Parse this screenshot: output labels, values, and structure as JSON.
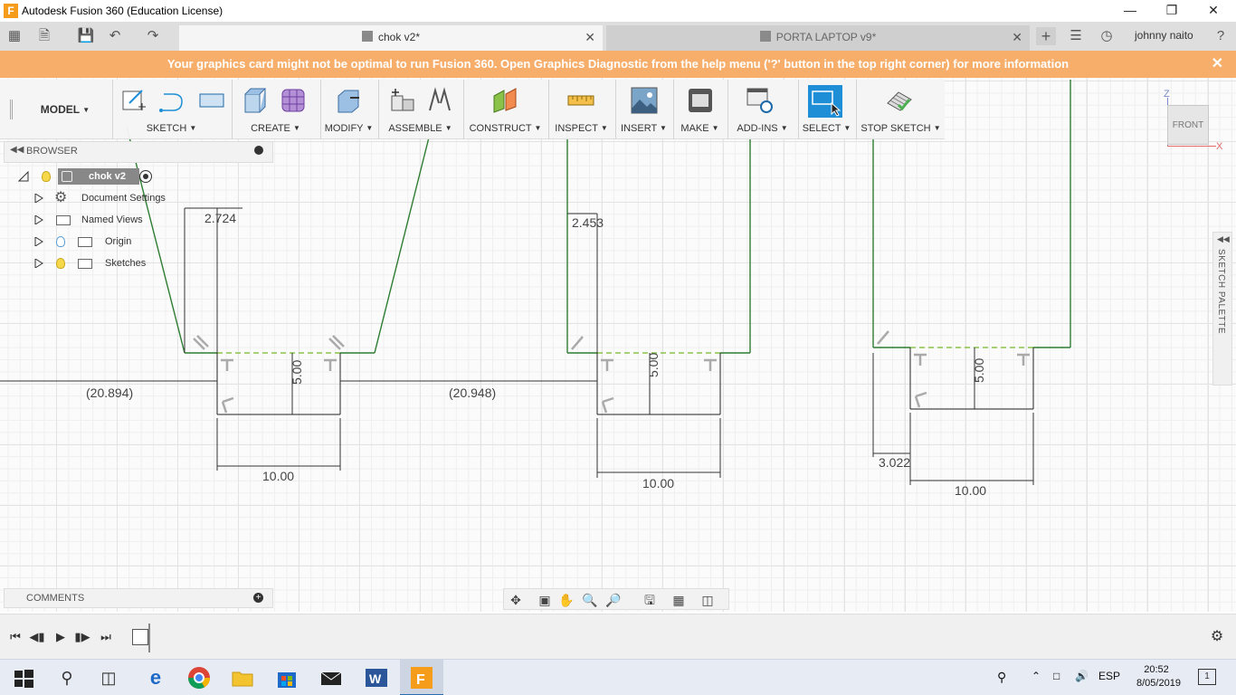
{
  "window": {
    "title": "Autodesk Fusion 360 (Education License)",
    "app_icon_letter": "F",
    "minimize_icon": "minimize-icon",
    "maximize_icon": "restore-icon",
    "close_icon": "close-icon"
  },
  "tabs": [
    {
      "label": "chok v2*",
      "active": true
    },
    {
      "label": "PORTA LAPTOP v9*",
      "active": false
    }
  ],
  "user": {
    "name": "johnny naito"
  },
  "banner": {
    "text": "Your graphics card might not be optimal to run Fusion 360. Open Graphics Diagnostic from the help menu ('?' button in the top right corner) for more information"
  },
  "toolbar": {
    "workspace": "MODEL",
    "groups": [
      {
        "label": "SKETCH"
      },
      {
        "label": "CREATE"
      },
      {
        "label": "MODIFY"
      },
      {
        "label": "ASSEMBLE"
      },
      {
        "label": "CONSTRUCT"
      },
      {
        "label": "INSPECT"
      },
      {
        "label": "INSERT"
      },
      {
        "label": "MAKE"
      },
      {
        "label": "ADD-INS"
      },
      {
        "label": "SELECT"
      },
      {
        "label": "STOP SKETCH"
      }
    ]
  },
  "browser": {
    "title": "BROWSER",
    "root": "chok v2",
    "items": [
      {
        "label": "Document Settings"
      },
      {
        "label": "Named Views"
      },
      {
        "label": "Origin"
      },
      {
        "label": "Sketches"
      }
    ]
  },
  "comments": {
    "title": "COMMENTS"
  },
  "viewcube": {
    "face": "FRONT",
    "z_label": "Z",
    "x_label": "X"
  },
  "sketch_palette": {
    "label": "SKETCH PALETTE"
  },
  "dimensions": {
    "d1": "2.724",
    "d2": "2.453",
    "d3": "(20.894)",
    "d4": "(20.948)",
    "d5": "5.00",
    "d6": "5.00",
    "d7": "5.00",
    "d8": "10.00",
    "d9": "10.00",
    "d10": "10.00",
    "d11": "3.022"
  },
  "taskbar": {
    "language": "ESP",
    "time": "20:52",
    "date": "8/05/2019",
    "notification_count": "1"
  },
  "colors": {
    "banner": "#f8ae6b",
    "sketch_line": "#2e7d32",
    "select_active": "#1e8fd6"
  }
}
